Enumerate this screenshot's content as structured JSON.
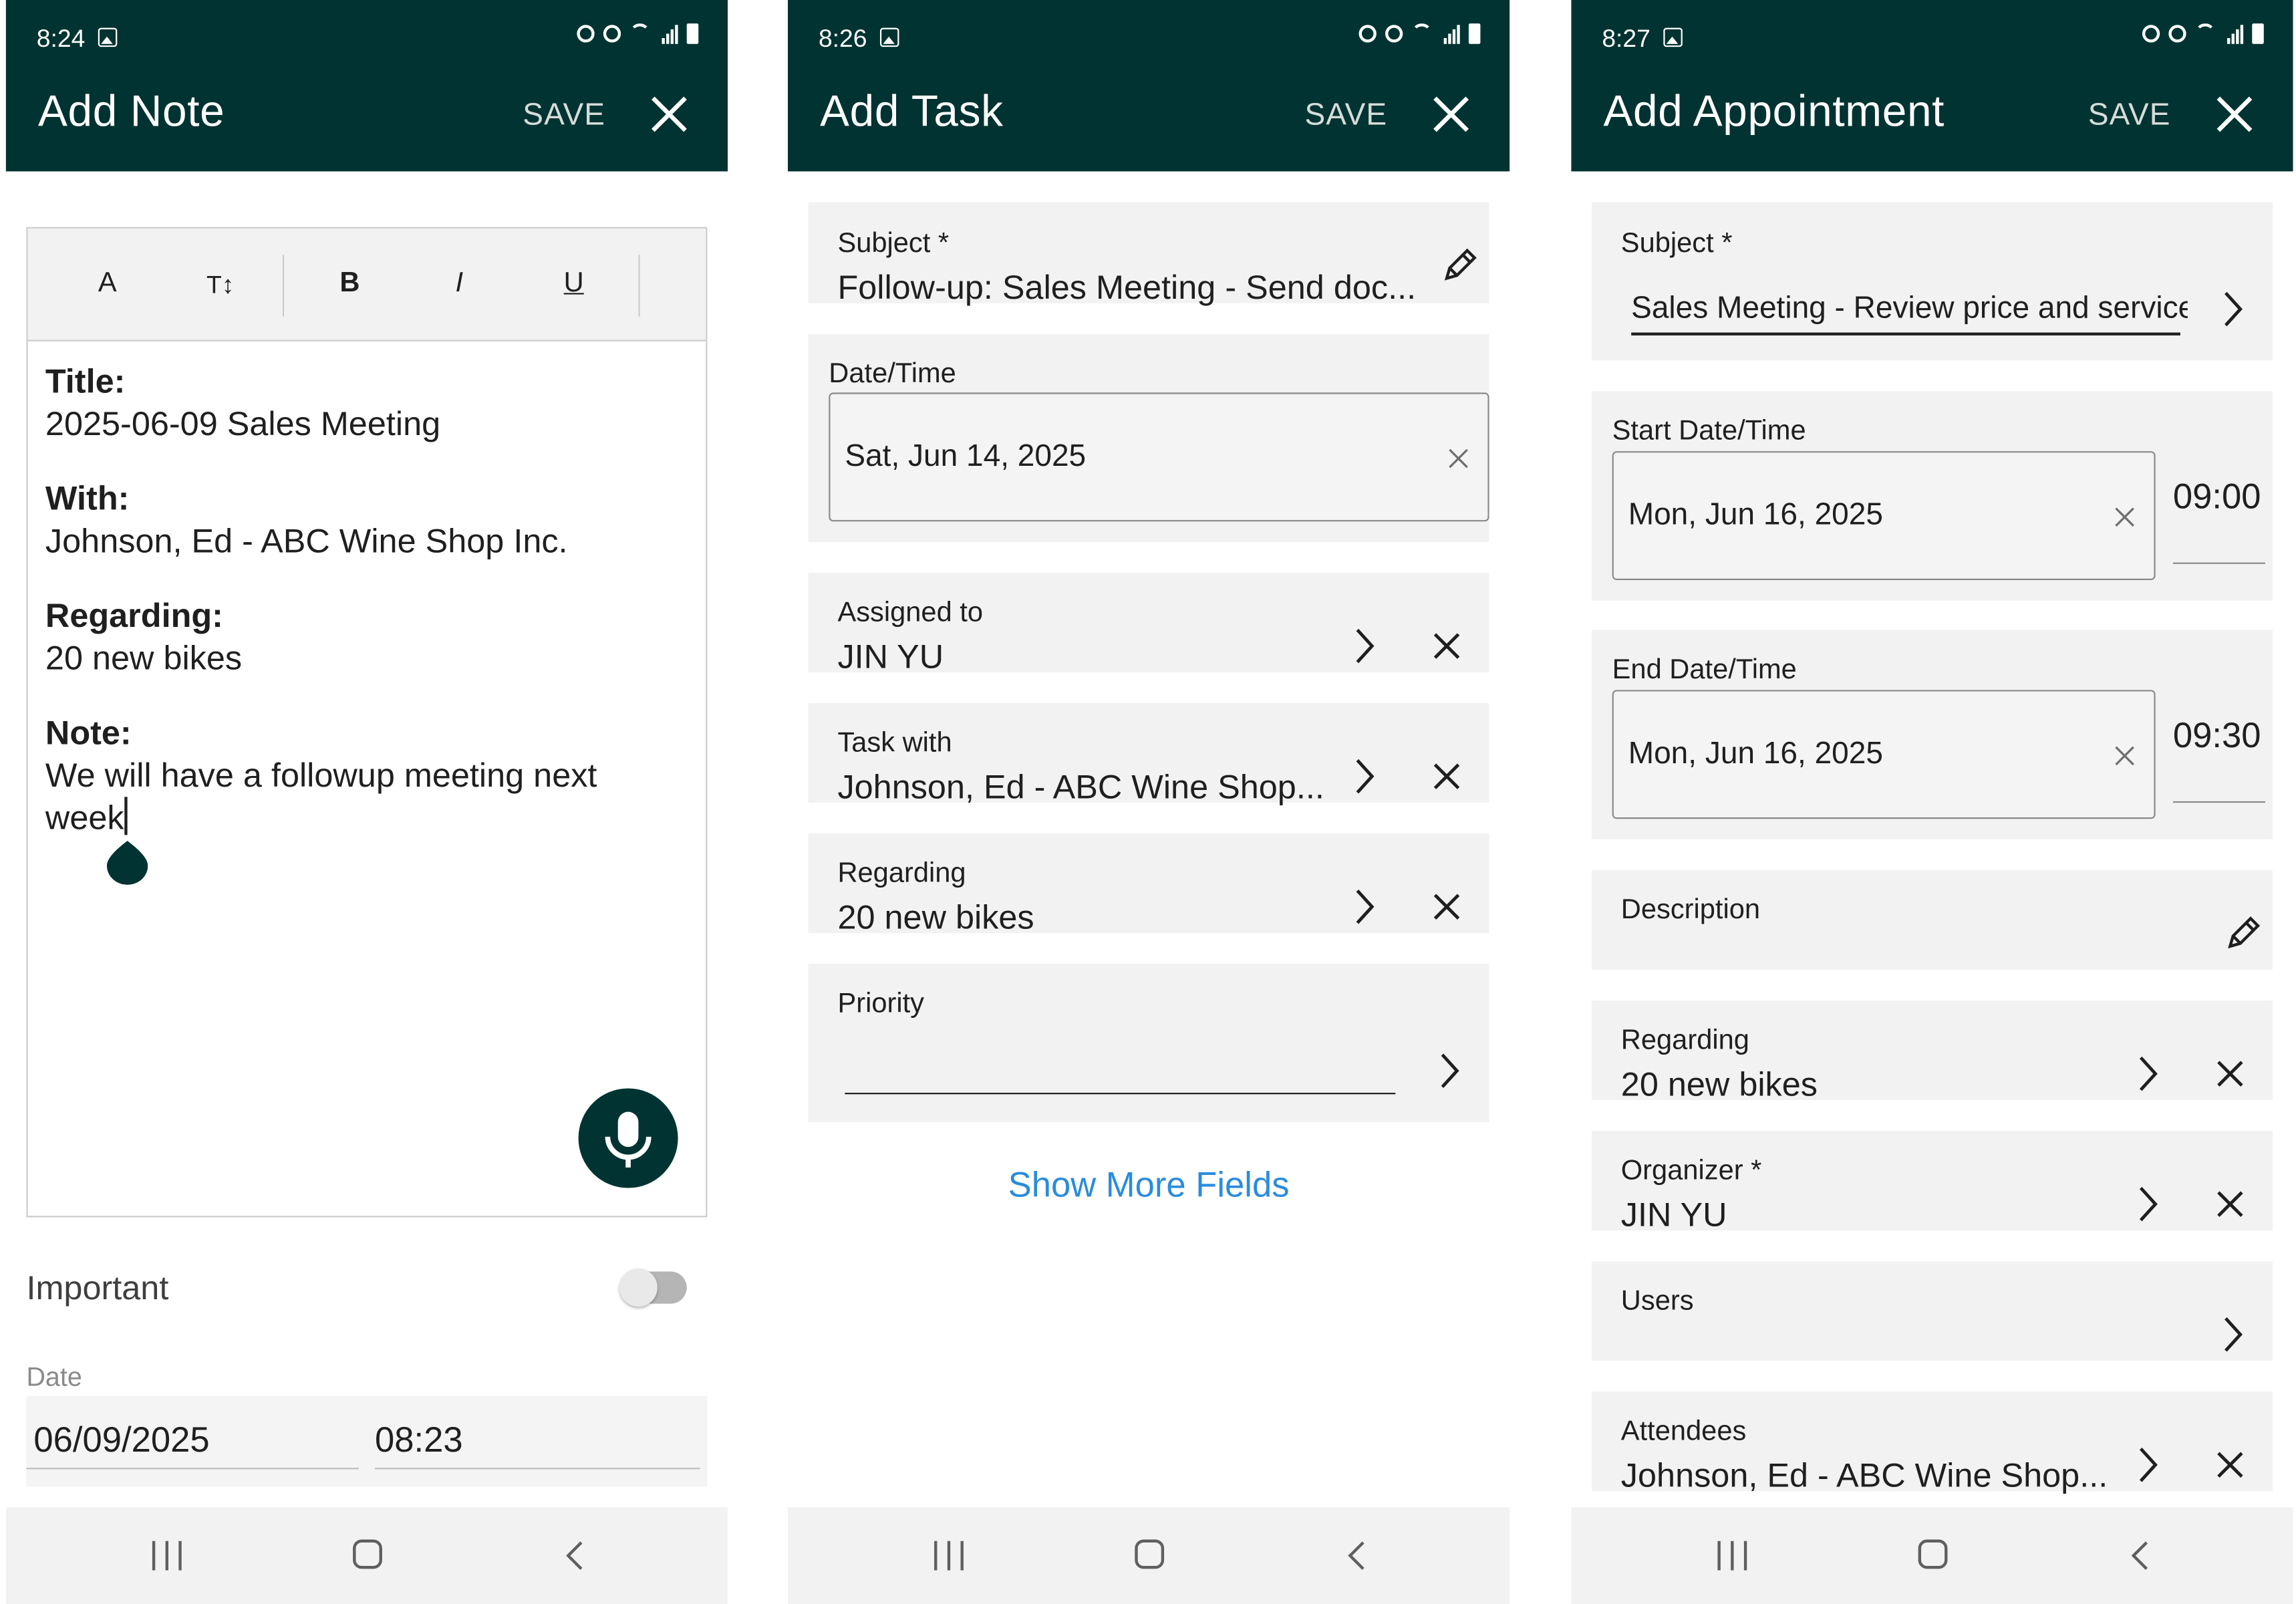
{
  "screens": [
    {
      "status": {
        "time": "8:24"
      },
      "title": "Add Note",
      "save_label": "SAVE",
      "toolbar": [
        "A",
        "T↕",
        "B",
        "I",
        "U"
      ],
      "note": {
        "title_label": "Title:",
        "title_value": "2025-06-09 Sales Meeting",
        "with_label": "With:",
        "with_value": "Johnson, Ed - ABC Wine Shop Inc.",
        "regarding_label": "Regarding:",
        "regarding_value": "20 new bikes",
        "note_label": "Note:",
        "note_value_line1": "We will have a followup meeting next",
        "note_value_line2": "week"
      },
      "important_label": "Important",
      "important_on": false,
      "date_label": "Date",
      "date_value": "06/09/2025",
      "time_value": "08:23"
    },
    {
      "status": {
        "time": "8:26"
      },
      "title": "Add Task",
      "save_label": "SAVE",
      "subject": {
        "label": "Subject *",
        "value": "Follow-up: Sales Meeting - Send doc..."
      },
      "datetime": {
        "label": "Date/Time",
        "value": "Sat, Jun 14, 2025"
      },
      "assigned": {
        "label": "Assigned to",
        "value": "JIN YU"
      },
      "task_with": {
        "label": "Task with",
        "value": "Johnson, Ed - ABC Wine Shop..."
      },
      "regarding": {
        "label": "Regarding",
        "value": "20 new bikes"
      },
      "priority": {
        "label": "Priority",
        "value": ""
      },
      "show_more": "Show More Fields"
    },
    {
      "status": {
        "time": "8:27"
      },
      "title": "Add Appointment",
      "save_label": "SAVE",
      "subject": {
        "label": "Subject *",
        "value": "Sales Meeting - Review price and service"
      },
      "start": {
        "label": "Start Date/Time",
        "date": "Mon, Jun 16, 2025",
        "time": "09:00"
      },
      "end": {
        "label": "End Date/Time",
        "date": "Mon, Jun 16, 2025",
        "time": "09:30"
      },
      "description": {
        "label": "Description"
      },
      "regarding": {
        "label": "Regarding",
        "value": "20 new bikes"
      },
      "organizer": {
        "label": "Organizer *",
        "value": "JIN YU"
      },
      "users": {
        "label": "Users"
      },
      "attendees": {
        "label": "Attendees",
        "value": "Johnson, Ed - ABC Wine Shop..."
      }
    }
  ],
  "colors": {
    "app_bar": "#003331",
    "card_bg": "#f2f2f2",
    "link": "#2a8cdc",
    "nav_bar": "#f2f2f2"
  },
  "icons": [
    "image-icon",
    "alarm-icon",
    "wifi-icon",
    "signal-icon",
    "battery-icon",
    "close-icon",
    "chevron-right-icon",
    "pencil-icon",
    "microphone-icon",
    "recent-apps-icon",
    "home-icon",
    "back-icon"
  ]
}
